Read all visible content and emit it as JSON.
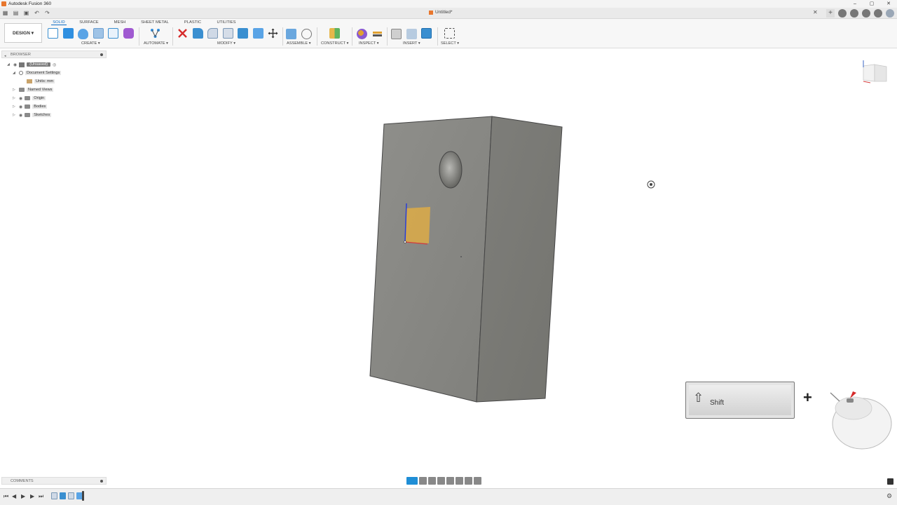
{
  "window": {
    "title": "Autodesk Fusion 360",
    "minimize": "–",
    "maximize": "▢",
    "close": "✕"
  },
  "document": {
    "tab_title": "Untitled*",
    "close": "✕"
  },
  "ribbon": {
    "workspace": "DESIGN ▾",
    "tabs": [
      "SOLID",
      "SURFACE",
      "MESH",
      "SHEET METAL",
      "PLASTIC",
      "UTILITIES"
    ],
    "active_tab": "SOLID",
    "groups": [
      "CREATE ▾",
      "AUTOMATE ▾",
      "MODIFY ▾",
      "ASSEMBLE ▾",
      "CONSTRUCT ▾",
      "INSPECT ▾",
      "INSERT ▾",
      "SELECT ▾"
    ]
  },
  "browser": {
    "header": "BROWSER",
    "items": [
      {
        "label": "(Unsaved)"
      },
      {
        "label": "Document Settings"
      },
      {
        "label": "Units: mm"
      },
      {
        "label": "Named Views"
      },
      {
        "label": "Origin"
      },
      {
        "label": "Bodies"
      },
      {
        "label": "Sketches"
      }
    ]
  },
  "overlay": {
    "shift_label": "Shift",
    "plus": "+"
  },
  "comments": {
    "header": "COMMENTS"
  },
  "colors": {
    "accent": "#0b6bc4",
    "body_front": "#878783",
    "body_side": "#7a7a76",
    "sketch_fill": "#d8aa4a"
  }
}
